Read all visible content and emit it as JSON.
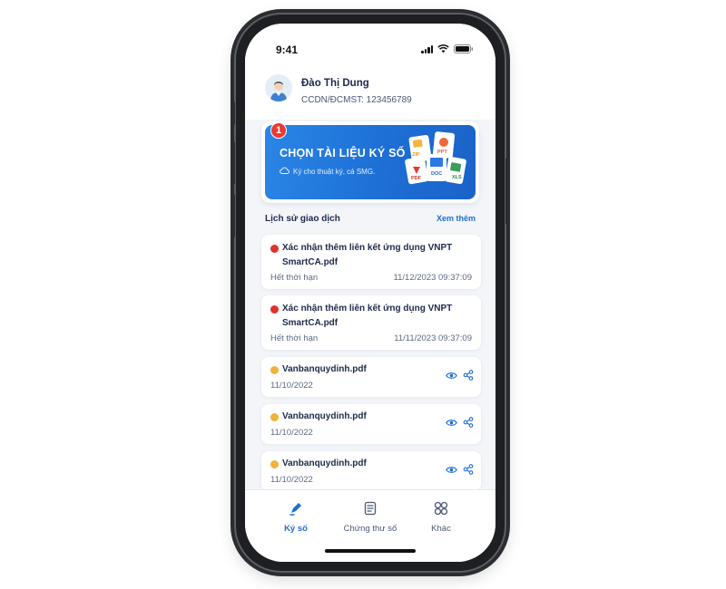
{
  "status_bar": {
    "time": "9:41"
  },
  "header": {
    "user_name": "Đào Thị Dung",
    "user_id": "CCDN/ĐCMST: 123456789"
  },
  "banner": {
    "step": "1",
    "title": "CHỌN TÀI LIỆU KÝ SỐ",
    "subtitle": "Ký cho thuật ký, cá SMG.",
    "doc_labels": [
      "ZIP",
      "PPT",
      "PDF",
      "DOC",
      "XLS"
    ]
  },
  "history": {
    "title": "Lịch sử giao dịch",
    "more_label": "Xem thêm",
    "items": [
      {
        "name": "Xác nhận thêm liên kết ứng dụng VNPT SmartCA.pdf",
        "status": "Hết thời hạn",
        "time": "11/12/2023 09:37:09",
        "dot_color": "#e0312b"
      },
      {
        "name": "Xác nhận thêm liên kết ứng dụng VNPT SmartCA.pdf",
        "status": "Hết thời hạn",
        "time": "11/11/2023 09:37:09",
        "dot_color": "#e0312b"
      },
      {
        "name": "Vanbanquydinh.pdf",
        "date": "11/10/2022",
        "dot_color": "#f0b23a"
      },
      {
        "name": "Vanbanquydinh.pdf",
        "date": "11/10/2022",
        "dot_color": "#f0b23a"
      },
      {
        "name": "Vanbanquydinh.pdf",
        "date": "11/10/2022",
        "dot_color": "#f0b23a"
      }
    ]
  },
  "bottom_nav": {
    "sign_label": "Ký số",
    "cert_label": "Chứng thư số",
    "other_label": "Khác"
  },
  "colors": {
    "accent": "#1f6fd1",
    "banner": "#1d6fd6",
    "expired_dot": "#e0312b",
    "pending_dot": "#f0b23a"
  }
}
